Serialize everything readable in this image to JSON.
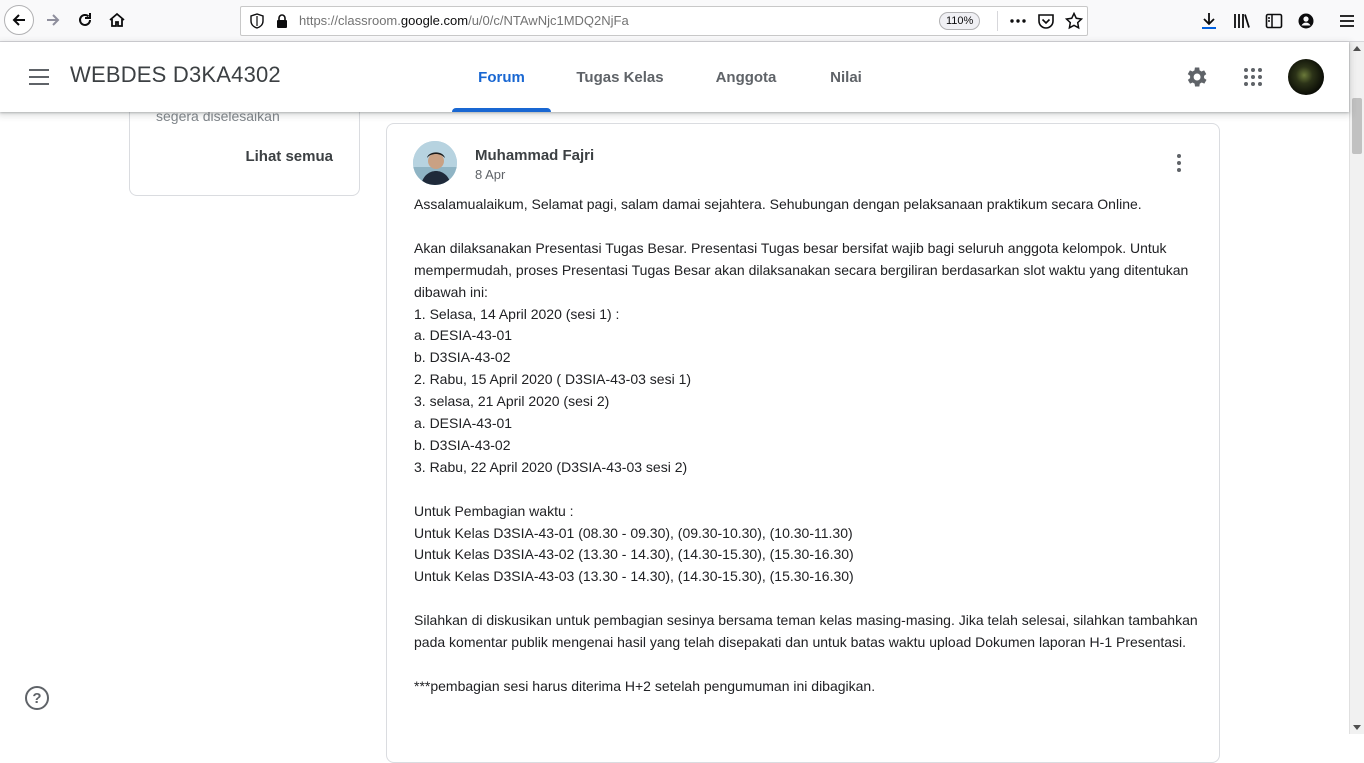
{
  "browser": {
    "url_prefix": "https://classroom.",
    "url_domain": "google.com",
    "url_path": "/u/0/c/NTAwNjc1MDQ2NjFa",
    "zoom": "110%"
  },
  "header": {
    "class_title": "WEBDES D3KA4302",
    "tabs": [
      {
        "label": "Forum",
        "active": true
      },
      {
        "label": "Tugas Kelas"
      },
      {
        "label": "Anggota"
      },
      {
        "label": "Nilai"
      }
    ]
  },
  "sidebar_card": {
    "upcoming_text": "segera diselesaikan",
    "view_all": "Lihat semua"
  },
  "post": {
    "author": "Muhammad Fajri",
    "date": "8 Apr",
    "paragraphs": [
      [
        "Assalamualaikum, Selamat pagi, salam damai sejahtera. Sehubungan dengan pelaksanaan praktikum secara Online."
      ],
      [
        "Akan dilaksanakan Presentasi Tugas Besar. Presentasi Tugas besar bersifat wajib bagi seluruh anggota kelompok. Untuk mempermudah, proses Presentasi Tugas Besar akan dilaksanakan secara bergiliran berdasarkan slot waktu yang ditentukan dibawah ini:",
        "1. Selasa, 14 April 2020 (sesi 1) :",
        "a. DESIA-43-01",
        "b. D3SIA-43-02",
        "2. Rabu, 15 April 2020 ( D3SIA-43-03 sesi 1)",
        "3. selasa, 21 April 2020 (sesi 2)",
        "a. DESIA-43-01",
        "b. D3SIA-43-02",
        "3. Rabu, 22 April 2020 (D3SIA-43-03 sesi 2)"
      ],
      [
        "Untuk Pembagian waktu :",
        "Untuk Kelas D3SIA-43-01 (08.30 - 09.30), (09.30-10.30), (10.30-11.30)",
        "Untuk Kelas D3SIA-43-02 (13.30 - 14.30), (14.30-15.30), (15.30-16.30)",
        "Untuk Kelas D3SIA-43-03 (13.30 - 14.30), (14.30-15.30), (15.30-16.30)"
      ],
      [
        "Silahkan di diskusikan untuk pembagian sesinya bersama teman kelas masing-masing. Jika telah selesai, silahkan tambahkan pada komentar publik mengenai hasil yang telah disepakati dan untuk batas waktu upload Dokumen laporan H-1 Presentasi."
      ],
      [
        "***pembagian sesi harus diterima H+2 setelah pengumuman ini dibagikan."
      ]
    ]
  },
  "help": {
    "label": "?"
  },
  "colors": {
    "accent": "#1967d2",
    "text": "#3c4043",
    "border": "#dadce0"
  }
}
